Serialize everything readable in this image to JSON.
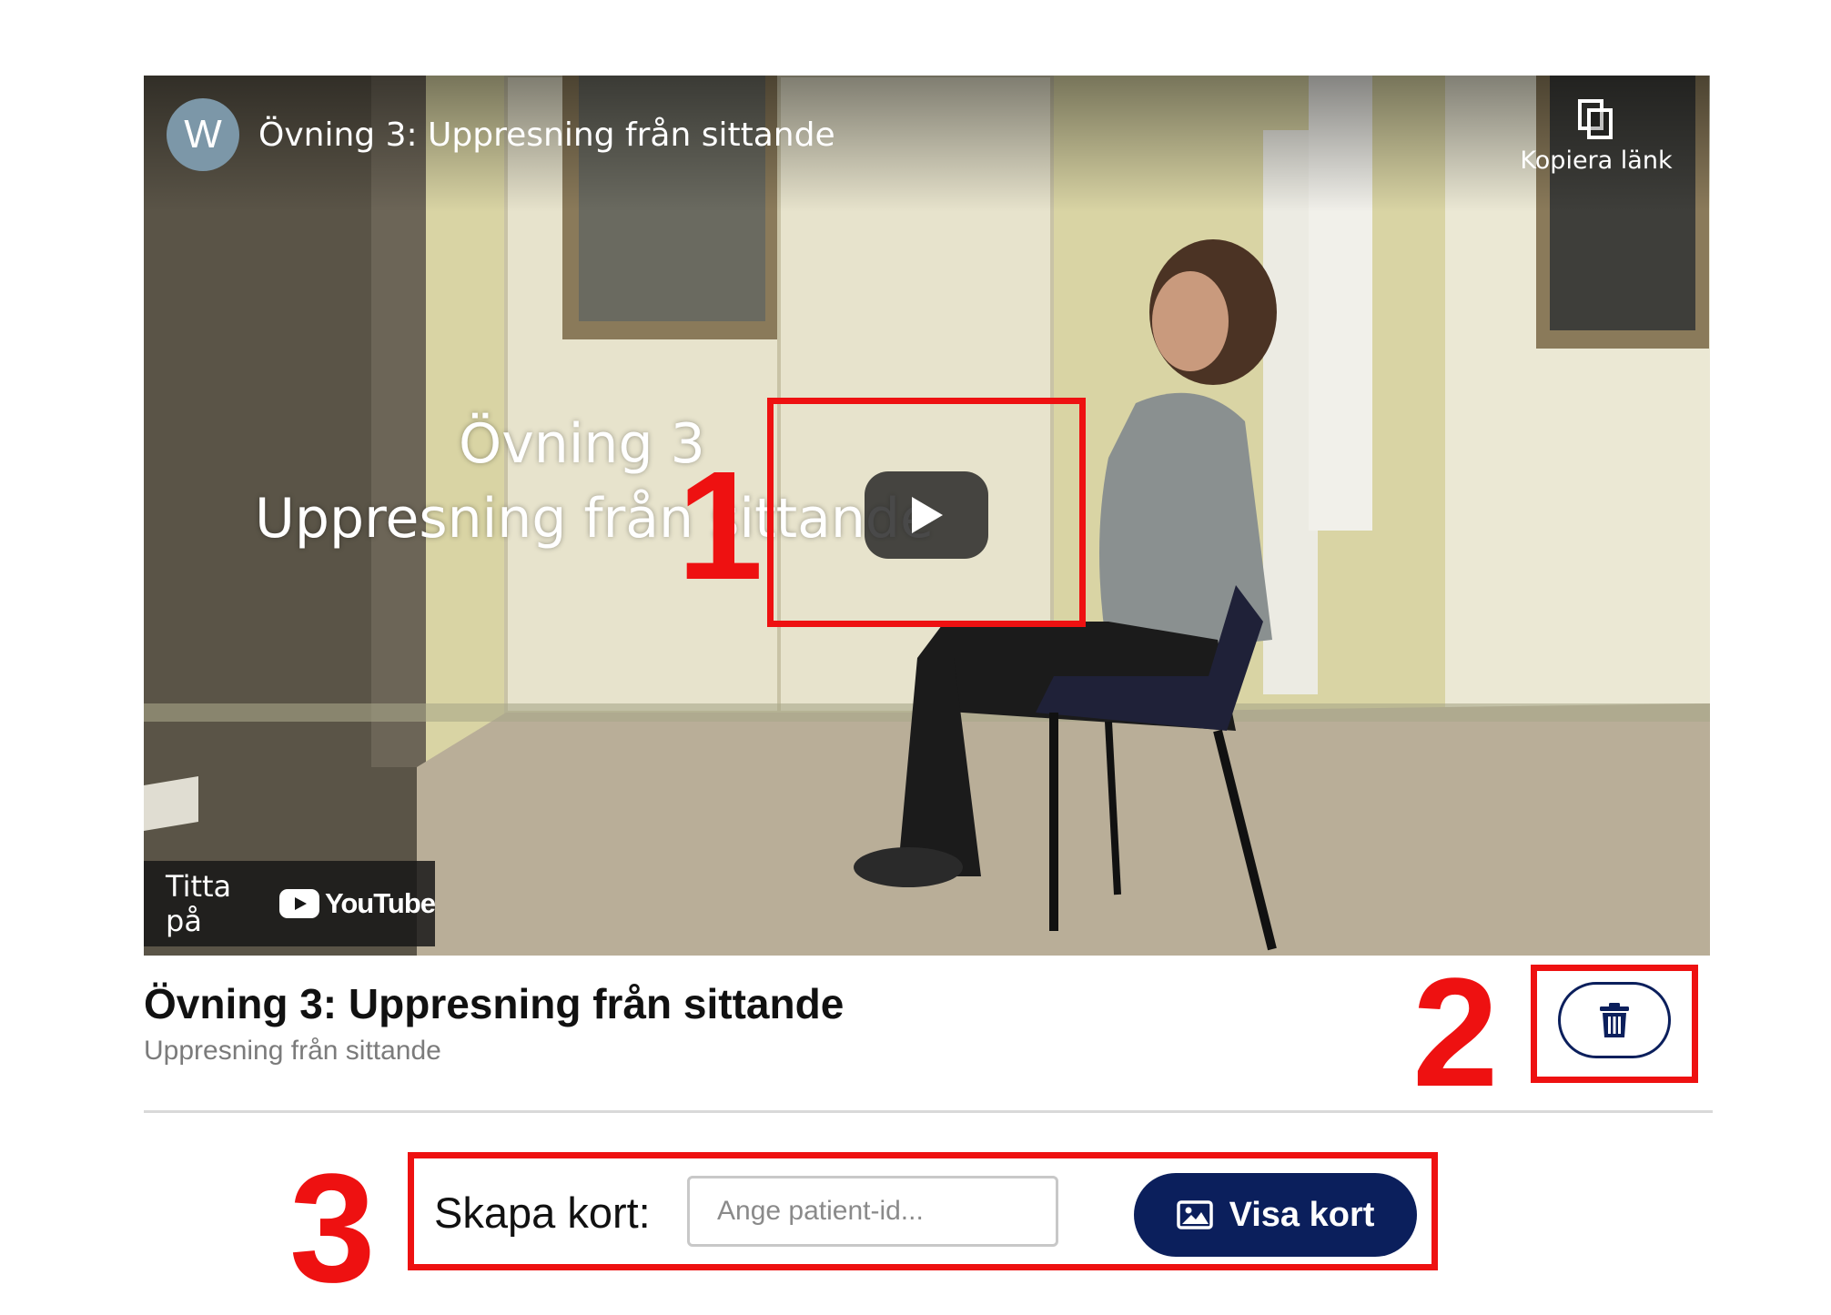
{
  "video": {
    "channel_initial": "W",
    "title": "Övning 3: Uppresning från sittande",
    "copy_link_label": "Kopiera länk",
    "overlay_line1": "Övning 3",
    "overlay_line2": "Uppresning från sittande",
    "watch_on_label": "Titta på",
    "youtube_label": "YouTube"
  },
  "exercise": {
    "title": "Övning 3: Uppresning från sittande",
    "subtitle": "Uppresning från sittande"
  },
  "create_card": {
    "label": "Skapa kort:",
    "input_placeholder": "Ange patient-id...",
    "input_value": "",
    "button_label": "Visa kort"
  },
  "annotations": [
    "1",
    "2",
    "3"
  ],
  "colors": {
    "brand_navy": "#0b1f5c",
    "annotation_red": "#ee1111",
    "subtitle_gray": "#7b7b7b"
  }
}
